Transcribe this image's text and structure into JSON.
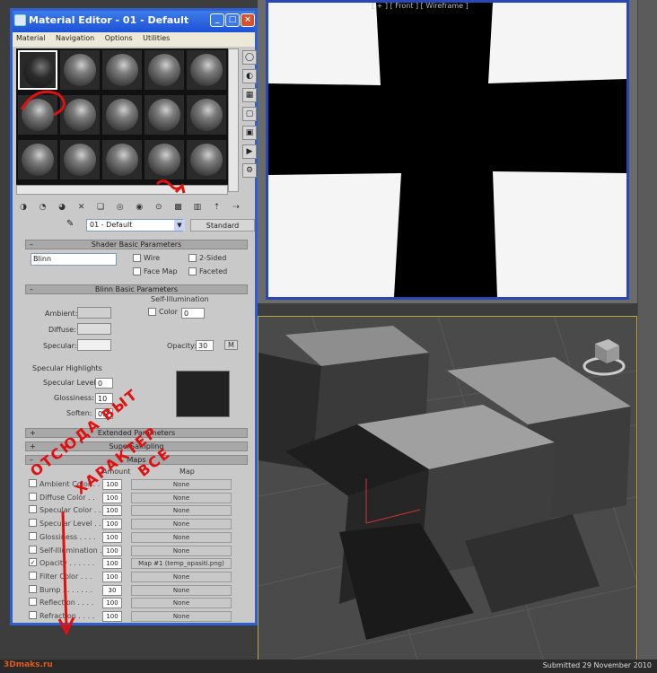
{
  "viewport_top": {
    "label": "[ + ] [ Front ] [ Wireframe ]"
  },
  "window": {
    "title": "Material Editor - 01 - Default",
    "controls": [
      "_",
      "□",
      "×"
    ]
  },
  "menu": [
    "Material",
    "Navigation",
    "Options",
    "Utilities"
  ],
  "material": {
    "name": "01 - Default",
    "type": "Standard"
  },
  "shader_basic": {
    "header": "Shader Basic Parameters",
    "shader": "Blinn",
    "wire": "Wire",
    "two_sided": "2-Sided",
    "face_map": "Face Map",
    "faceted": "Faceted"
  },
  "blinn_basic": {
    "header": "Blinn Basic Parameters",
    "self_illum_title": "Self-Illumination",
    "color_label": "Color",
    "color_value": "0",
    "ambient": "Ambient:",
    "diffuse": "Diffuse:",
    "specular": "Specular:",
    "opacity_label": "Opacity:",
    "opacity_value": "30",
    "m_button": "M",
    "spec_highlights": "Specular Highlights",
    "spec_level": "Specular Level:",
    "spec_level_value": "0",
    "glossiness": "Glossiness:",
    "glossiness_value": "10",
    "soften": "Soften:",
    "soften_value": "0.1"
  },
  "extended": {
    "header": "Extended Parameters"
  },
  "supersampling": {
    "header": "SuperSampling"
  },
  "maps": {
    "header": "Maps",
    "col_amount": "Amount",
    "col_map": "Map",
    "rows": [
      {
        "name": "Ambient Color . .",
        "amount": "100",
        "map": "None",
        "checked": false
      },
      {
        "name": "Diffuse Color . .",
        "amount": "100",
        "map": "None",
        "checked": false
      },
      {
        "name": "Specular Color . .",
        "amount": "100",
        "map": "None",
        "checked": false
      },
      {
        "name": "Specular Level . .",
        "amount": "100",
        "map": "None",
        "checked": false
      },
      {
        "name": "Glossiness . . . .",
        "amount": "100",
        "map": "None",
        "checked": false
      },
      {
        "name": "Self-Illumination .",
        "amount": "100",
        "map": "None",
        "checked": false
      },
      {
        "name": "Opacity . . . . . .",
        "amount": "100",
        "map": "Map #1 (temp_opasiti.png)",
        "checked": true
      },
      {
        "name": "Filter Color . . .",
        "amount": "100",
        "map": "None",
        "checked": false
      },
      {
        "name": "Bump . . . . . . .",
        "amount": "30",
        "map": "None",
        "checked": false
      },
      {
        "name": "Reflection . . . .",
        "amount": "100",
        "map": "None",
        "checked": false
      },
      {
        "name": "Refraction . . . .",
        "amount": "100",
        "map": "None",
        "checked": false
      }
    ]
  },
  "annotation": {
    "line1": "ОТСЮДА ВЫТ",
    "line2": "ХАРАКТЕР",
    "line3": "ВСЕ"
  },
  "status": {
    "logo": "3Dmaks.ru",
    "submitted": "Submitted 29 November 2010"
  },
  "colors": {
    "title_bar": "#1c52d6",
    "viewport_highlight": "#b8a640",
    "annotation_red": "#e01010"
  }
}
